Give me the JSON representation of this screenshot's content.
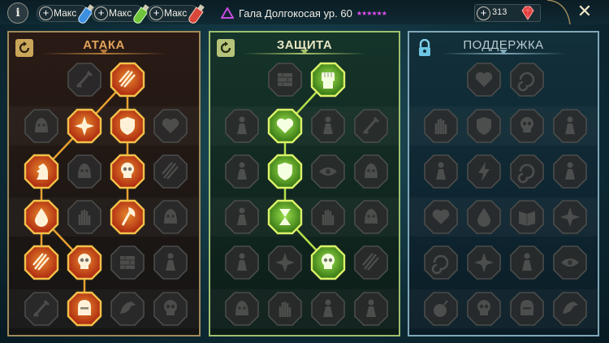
{
  "topbar": {
    "info_glyph": "i",
    "resources": [
      {
        "label": "Макс",
        "icon": "blue-potion-icon",
        "color": "#4aa3ff"
      },
      {
        "label": "Макс",
        "icon": "green-potion-icon",
        "color": "#7ad04a"
      },
      {
        "label": "Макс",
        "icon": "red-potion-icon",
        "color": "#e05040"
      }
    ],
    "champion": {
      "name": "Гала Долгокосая ур. 60",
      "stars": "★★★★★★",
      "rarity_color": "#c74ae0"
    },
    "gems": {
      "value": "313",
      "icon": "gem-icon"
    },
    "close_glyph": "✕"
  },
  "panels": {
    "attack": {
      "title": "АТАКА",
      "accent": "#e08a2a",
      "reset_icon": "reset-icon"
    },
    "defense": {
      "title": "ЗАЩИТА",
      "accent": "#8ad83a",
      "reset_icon": "reset-icon"
    },
    "support": {
      "title": "ПОДДЕРЖКА",
      "accent": "#7fb0c0",
      "lock_icon": "lock-icon"
    }
  },
  "trees": {
    "attack": {
      "nodes": [
        {
          "r": 0,
          "c": 1,
          "active": false,
          "icon": "crossed-swords-icon"
        },
        {
          "r": 0,
          "c": 2,
          "active": true,
          "icon": "claw-slash-icon"
        },
        {
          "r": 1,
          "c": 0,
          "active": false,
          "icon": "demon-mask-icon"
        },
        {
          "r": 1,
          "c": 1,
          "active": true,
          "icon": "sword-burst-icon"
        },
        {
          "r": 1,
          "c": 2,
          "active": true,
          "icon": "shield-break-icon"
        },
        {
          "r": 1,
          "c": 3,
          "active": false,
          "icon": "broken-heart-icon"
        },
        {
          "r": 2,
          "c": 0,
          "active": true,
          "icon": "chess-knight-icon"
        },
        {
          "r": 2,
          "c": 1,
          "active": false,
          "icon": "beast-head-icon"
        },
        {
          "r": 2,
          "c": 2,
          "active": true,
          "icon": "skull-crossbones-icon"
        },
        {
          "r": 2,
          "c": 3,
          "active": false,
          "icon": "scythe-icon"
        },
        {
          "r": 3,
          "c": 0,
          "active": true,
          "icon": "blood-drop-icon"
        },
        {
          "r": 3,
          "c": 1,
          "active": false,
          "icon": "clawed-hand-icon"
        },
        {
          "r": 3,
          "c": 2,
          "active": true,
          "icon": "battle-axe-icon"
        },
        {
          "r": 3,
          "c": 3,
          "active": false,
          "icon": "tribal-mask-icon"
        },
        {
          "r": 4,
          "c": 0,
          "active": true,
          "icon": "triple-slash-icon"
        },
        {
          "r": 4,
          "c": 1,
          "active": true,
          "icon": "twin-skulls-icon"
        },
        {
          "r": 4,
          "c": 2,
          "active": false,
          "icon": "pillars-icon"
        },
        {
          "r": 4,
          "c": 3,
          "active": false,
          "icon": "warrior-icon"
        },
        {
          "r": 5,
          "c": 0,
          "active": false,
          "icon": "thrown-blades-icon"
        },
        {
          "r": 5,
          "c": 1,
          "active": true,
          "icon": "knight-helmet-icon"
        },
        {
          "r": 5,
          "c": 2,
          "active": false,
          "icon": "winged-demon-icon"
        },
        {
          "r": 5,
          "c": 3,
          "active": false,
          "icon": "skull-pile-icon"
        }
      ],
      "links": [
        [
          0,
          2,
          1,
          1
        ],
        [
          0,
          2,
          1,
          2
        ],
        [
          1,
          1,
          2,
          0
        ],
        [
          1,
          2,
          2,
          2
        ],
        [
          2,
          0,
          3,
          0
        ],
        [
          2,
          2,
          3,
          2
        ],
        [
          3,
          0,
          4,
          0
        ],
        [
          3,
          0,
          4,
          1
        ],
        [
          4,
          1,
          5,
          1
        ]
      ]
    },
    "defense": {
      "nodes": [
        {
          "r": 0,
          "c": 1,
          "active": false,
          "icon": "brick-wall-icon"
        },
        {
          "r": 0,
          "c": 2,
          "active": true,
          "icon": "raised-fist-icon"
        },
        {
          "r": 1,
          "c": 0,
          "active": false,
          "icon": "cloaked-figure-icon"
        },
        {
          "r": 1,
          "c": 1,
          "active": true,
          "icon": "heart-hand-icon"
        },
        {
          "r": 1,
          "c": 2,
          "active": false,
          "icon": "knight-pose-icon"
        },
        {
          "r": 1,
          "c": 3,
          "active": false,
          "icon": "sword-slash-icon"
        },
        {
          "r": 2,
          "c": 0,
          "active": false,
          "icon": "dancer-icon"
        },
        {
          "r": 2,
          "c": 1,
          "active": true,
          "icon": "shield-sword-icon"
        },
        {
          "r": 2,
          "c": 2,
          "active": false,
          "icon": "eye-shield-icon"
        },
        {
          "r": 2,
          "c": 3,
          "active": false,
          "icon": "hooded-face-icon"
        },
        {
          "r": 3,
          "c": 0,
          "active": false,
          "icon": "standing-figure-icon"
        },
        {
          "r": 3,
          "c": 1,
          "active": true,
          "icon": "hourglass-icon"
        },
        {
          "r": 3,
          "c": 2,
          "active": false,
          "icon": "spiked-hand-icon"
        },
        {
          "r": 3,
          "c": 3,
          "active": false,
          "icon": "bull-head-icon"
        },
        {
          "r": 4,
          "c": 0,
          "active": false,
          "icon": "running-figure-icon"
        },
        {
          "r": 4,
          "c": 1,
          "active": false,
          "icon": "fire-spikes-icon"
        },
        {
          "r": 4,
          "c": 2,
          "active": true,
          "icon": "radiant-skull-icon"
        },
        {
          "r": 4,
          "c": 3,
          "active": false,
          "icon": "comet-icon"
        },
        {
          "r": 5,
          "c": 0,
          "active": false,
          "icon": "lion-head-icon"
        },
        {
          "r": 5,
          "c": 1,
          "active": false,
          "icon": "tree-roots-icon"
        },
        {
          "r": 5,
          "c": 2,
          "active": false,
          "icon": "hooded-warrior-icon"
        },
        {
          "r": 5,
          "c": 3,
          "active": false,
          "icon": "robed-mage-icon"
        }
      ],
      "links": [
        [
          0,
          2,
          1,
          1
        ],
        [
          1,
          1,
          2,
          1
        ],
        [
          2,
          1,
          3,
          1
        ],
        [
          3,
          1,
          4,
          2
        ]
      ]
    },
    "support": {
      "nodes": [
        {
          "r": 0,
          "c": 1,
          "active": false,
          "icon": "heart-icon"
        },
        {
          "r": 0,
          "c": 2,
          "active": false,
          "icon": "swirl-icon"
        },
        {
          "r": 1,
          "c": 0,
          "active": false,
          "icon": "praying-hands-icon"
        },
        {
          "r": 1,
          "c": 1,
          "active": false,
          "icon": "round-shield-icon"
        },
        {
          "r": 1,
          "c": 2,
          "active": false,
          "icon": "flaming-skull-icon"
        },
        {
          "r": 1,
          "c": 3,
          "active": false,
          "icon": "dashing-figure-icon"
        },
        {
          "r": 2,
          "c": 0,
          "active": false,
          "icon": "leaping-figure-icon"
        },
        {
          "r": 2,
          "c": 1,
          "active": false,
          "icon": "lightning-icon"
        },
        {
          "r": 2,
          "c": 2,
          "active": false,
          "icon": "ribbon-wave-icon"
        },
        {
          "r": 2,
          "c": 3,
          "active": false,
          "icon": "standing-man-icon"
        },
        {
          "r": 3,
          "c": 0,
          "active": false,
          "icon": "heart-hands-icon"
        },
        {
          "r": 3,
          "c": 1,
          "active": false,
          "icon": "drop-burst-icon"
        },
        {
          "r": 3,
          "c": 2,
          "active": false,
          "icon": "open-book-icon"
        },
        {
          "r": 3,
          "c": 3,
          "active": false,
          "icon": "rays-icon"
        },
        {
          "r": 4,
          "c": 0,
          "active": false,
          "icon": "tornado-icon"
        },
        {
          "r": 4,
          "c": 1,
          "active": false,
          "icon": "star-compass-icon"
        },
        {
          "r": 4,
          "c": 2,
          "active": false,
          "icon": "running-boots-icon"
        },
        {
          "r": 4,
          "c": 3,
          "active": false,
          "icon": "all-seeing-eye-icon"
        },
        {
          "r": 5,
          "c": 0,
          "active": false,
          "icon": "bomb-icon"
        },
        {
          "r": 5,
          "c": 1,
          "active": false,
          "icon": "skull-icon"
        },
        {
          "r": 5,
          "c": 2,
          "active": false,
          "icon": "horned-helmet-icon"
        },
        {
          "r": 5,
          "c": 3,
          "active": false,
          "icon": "eagle-head-icon"
        }
      ],
      "links": []
    }
  }
}
